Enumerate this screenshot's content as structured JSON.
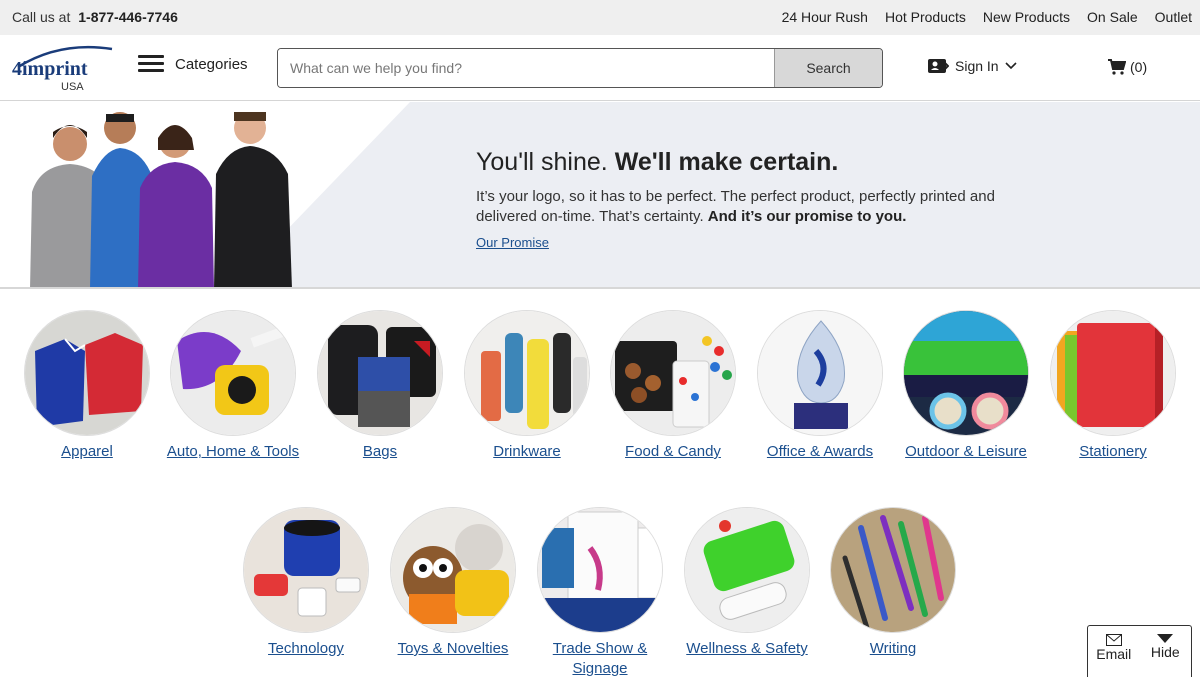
{
  "topbar": {
    "call_prefix": "Call us at",
    "phone": "1-877-446-7746",
    "links": [
      "24 Hour Rush",
      "Hot Products",
      "New Products",
      "On Sale",
      "Outlet"
    ]
  },
  "header": {
    "logo_text": "4imprint",
    "logo_sub": "USA",
    "categories_label": "Categories",
    "search_placeholder": "What can we help you find?",
    "search_button": "Search",
    "signin_label": "Sign In",
    "cart_count": "(0)"
  },
  "hero": {
    "title_light": "You'll shine.",
    "title_bold": "We'll make certain.",
    "body": "It’s your logo, so it has to be perfect. The perfect product, perfectly printed and delivered on-time. That’s certainty.",
    "body_bold": "And it’s our promise to you.",
    "link": "Our Promise"
  },
  "categories": [
    {
      "label": "Apparel",
      "icon": "apparel-icon"
    },
    {
      "label": "Auto, Home & Tools",
      "icon": "tape-measure-icon"
    },
    {
      "label": "Bags",
      "icon": "bag-icon"
    },
    {
      "label": "Drinkware",
      "icon": "bottle-icon"
    },
    {
      "label": "Food & Candy",
      "icon": "candy-icon"
    },
    {
      "label": "Office & Awards",
      "icon": "award-icon"
    },
    {
      "label": "Outdoor & Leisure",
      "icon": "sunglasses-icon"
    },
    {
      "label": "Stationery",
      "icon": "notebook-icon"
    },
    {
      "label": "Technology",
      "icon": "speaker-icon"
    },
    {
      "label": "Toys & Novelties",
      "icon": "plush-toy-icon"
    },
    {
      "label": "Trade Show & Signage",
      "icon": "banner-icon"
    },
    {
      "label": "Wellness & Safety",
      "icon": "first-aid-kit-icon"
    },
    {
      "label": "Writing",
      "icon": "pen-icon"
    }
  ],
  "widget": {
    "email_label": "Email",
    "hide_label": "Hide"
  },
  "colors": {
    "link": "#1b4f8e",
    "hero_bg": "#eceef3",
    "brand_blue": "#1a3c7a"
  }
}
